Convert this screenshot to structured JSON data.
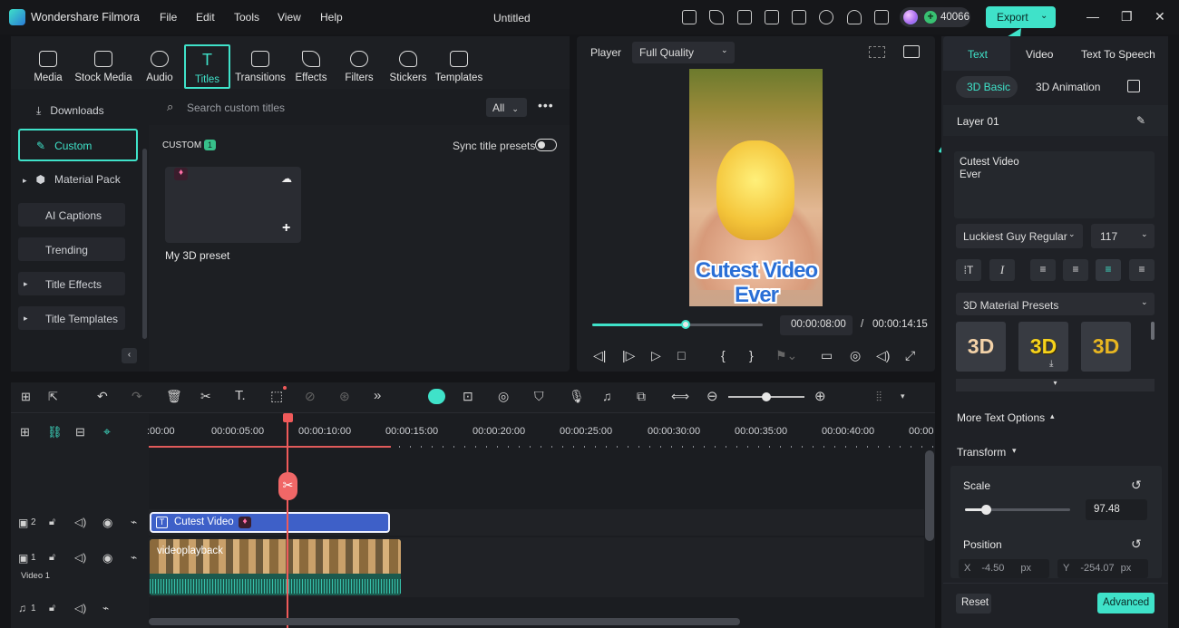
{
  "app": {
    "name": "Wondershare Filmora",
    "document": "Untitled",
    "credits": "40066",
    "export_label": "Export"
  },
  "menu": [
    "File",
    "Edit",
    "Tools",
    "View",
    "Help"
  ],
  "media_tabs": [
    "Media",
    "Stock Media",
    "Audio",
    "Titles",
    "Transitions",
    "Effects",
    "Filters",
    "Stickers",
    "Templates"
  ],
  "sidebar": {
    "items": [
      "Downloads",
      "Custom",
      "Material Pack",
      "AI Captions",
      "Trending",
      "Title Effects",
      "Title Templates"
    ]
  },
  "browser": {
    "search_placeholder": "Search custom titles",
    "filter": "All",
    "section": "CUSTOM",
    "count": "1",
    "sync_label": "Sync title presets",
    "preset_name": "My 3D preset"
  },
  "player": {
    "label": "Player",
    "quality": "Full Quality",
    "current": "00:00:08:00",
    "separator": "/",
    "total": "00:00:14:15",
    "progress": 0.55,
    "video_text_line1": "Cutest Video",
    "video_text_line2": "Ever"
  },
  "inspector": {
    "tabs": [
      "Text",
      "Video",
      "Text To Speech"
    ],
    "subtabs": [
      "3D Basic",
      "3D Animation"
    ],
    "layer": "Layer 01",
    "text_value_line1": "Cutest Video",
    "text_value_line2": "Ever",
    "font": "Luckiest Guy Regular",
    "size": "117",
    "presets_label": "3D Material Presets",
    "preset_letter": "3D",
    "more_options": "More Text Options",
    "transform": "Transform",
    "scale_label": "Scale",
    "scale_value": "97.48",
    "scale_level": 0.2,
    "position_label": "Position",
    "x_label": "X",
    "x_value": "-4.50",
    "x_unit": "px",
    "y_label": "Y",
    "y_value": "-254.07",
    "y_unit": "px",
    "reset": "Reset",
    "advanced": "Advanced"
  },
  "timeline": {
    "ticks": [
      ":00:00",
      "00:00:05:00",
      "00:00:10:00",
      "00:00:15:00",
      "00:00:20:00",
      "00:00:25:00",
      "00:00:30:00",
      "00:00:35:00",
      "00:00:40:00",
      "00:00:"
    ],
    "title_clip": "Cutest Video",
    "video_clip": "videoplayback",
    "video_track_label": "Video 1",
    "track_numbers": [
      "2",
      "1",
      "1"
    ]
  },
  "colors": {
    "accent": "#3fe2c9",
    "playhead": "#f05a5a",
    "title_clip": "#3e60c8"
  }
}
